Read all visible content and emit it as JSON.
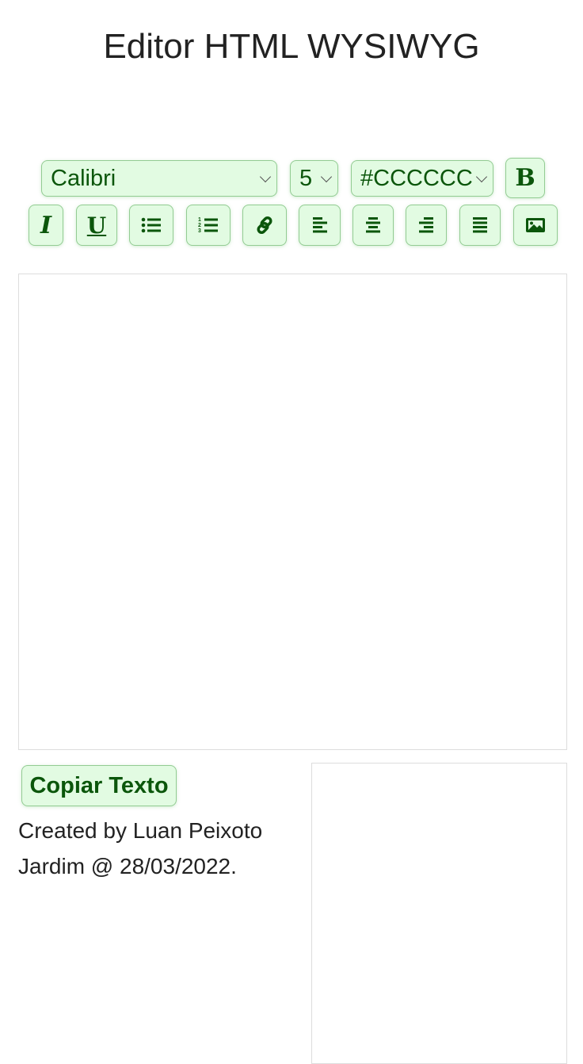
{
  "page": {
    "title": "Editor HTML WYSIWYG"
  },
  "toolbar": {
    "font_family": "Calibri",
    "font_size": "5",
    "font_color": "#CCCCCC",
    "bold_label": "B",
    "italic_label": "I",
    "underline_label": "U"
  },
  "actions": {
    "copy_label": "Copiar Texto"
  },
  "footer": {
    "credit_line1": "Created by Luan Peixoto",
    "credit_line2": "Jardim @ 28/03/2022."
  },
  "colors": {
    "accent_bg": "#e2fbe2",
    "accent_border": "#93cc93",
    "accent_text": "#0b560b"
  }
}
